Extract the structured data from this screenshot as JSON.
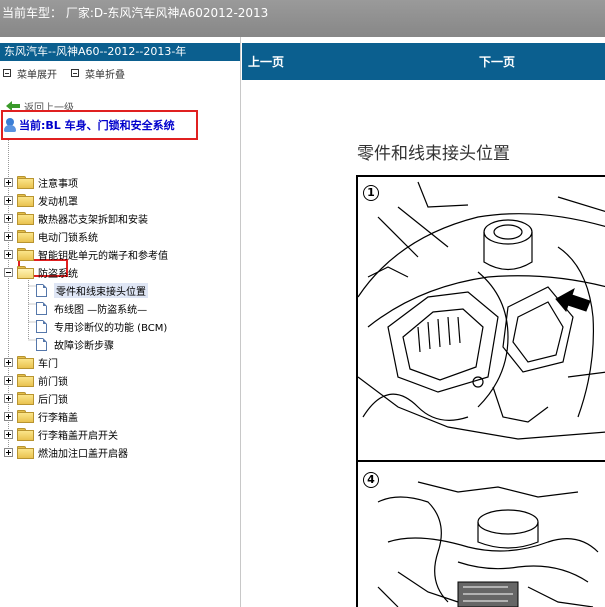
{
  "window": {
    "title": "当前车型： 厂家:D-东风汽车风神A602012-2013"
  },
  "left_pane": {
    "header": "东风汽车--风神A60--2012--2013-年",
    "menu_expand": "菜单展开",
    "menu_collapse": "菜单折叠",
    "back_label": "返回上一级",
    "current_label": "当前:BL 车身、门锁和安全系统",
    "tree": [
      {
        "label": "注意事项",
        "type": "folder",
        "expanded": false
      },
      {
        "label": "发动机罩",
        "type": "folder",
        "expanded": false
      },
      {
        "label": "散热器芯支架拆卸和安装",
        "type": "folder",
        "expanded": false
      },
      {
        "label": "电动门锁系统",
        "type": "folder",
        "expanded": false
      },
      {
        "label": "智能钥匙单元的端子和参考值",
        "type": "folder",
        "expanded": false
      },
      {
        "label": "防盗系统",
        "type": "folder",
        "expanded": true
      },
      {
        "label": "零件和线束接头位置",
        "type": "doc",
        "selected": true
      },
      {
        "label": "布线图 —防盗系统—",
        "type": "doc"
      },
      {
        "label": "专用诊断仪的功能 (BCM)",
        "type": "doc"
      },
      {
        "label": "故障诊断步骤",
        "type": "doc"
      },
      {
        "label": "车门",
        "type": "folder",
        "expanded": false
      },
      {
        "label": "前门锁",
        "type": "folder",
        "expanded": false
      },
      {
        "label": "后门锁",
        "type": "folder",
        "expanded": false
      },
      {
        "label": "行李箱盖",
        "type": "folder",
        "expanded": false
      },
      {
        "label": "行李箱盖开启开关",
        "type": "folder",
        "expanded": false
      },
      {
        "label": "燃油加注口盖开启器",
        "type": "folder",
        "expanded": false
      }
    ]
  },
  "right_pane": {
    "prev_page": "上一页",
    "next_page": "下一页",
    "section_title": "零件和线束接头位置",
    "diagram_badges": [
      "1",
      "4"
    ]
  },
  "colors": {
    "nav_blue": "#0b5f8f",
    "highlight_red": "#e02020",
    "current_text_blue": "#0000cc"
  }
}
